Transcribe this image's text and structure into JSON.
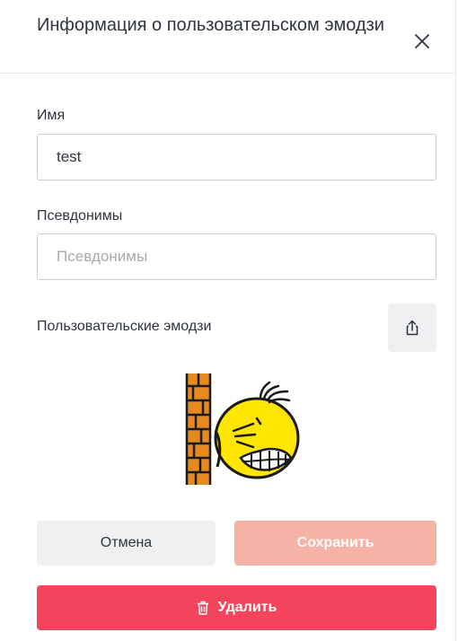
{
  "header": {
    "title": "Информация о пользовательском эмодзи",
    "close_icon": "close-icon"
  },
  "name_field": {
    "label": "Имя",
    "value": "test"
  },
  "aliases_field": {
    "label": "Псевдонимы",
    "value": "",
    "placeholder": "Псевдонимы"
  },
  "emoji_section": {
    "label": "Пользовательские эмодзи",
    "upload_icon": "upload-icon"
  },
  "actions": {
    "cancel_label": "Отмена",
    "save_label": "Сохранить",
    "delete_label": "Удалить",
    "delete_icon": "trash-icon"
  },
  "colors": {
    "danger": "#f5455c",
    "danger_disabled": "#f5b3a5",
    "neutral_button": "#eeeff1",
    "text": "#2f343d"
  }
}
